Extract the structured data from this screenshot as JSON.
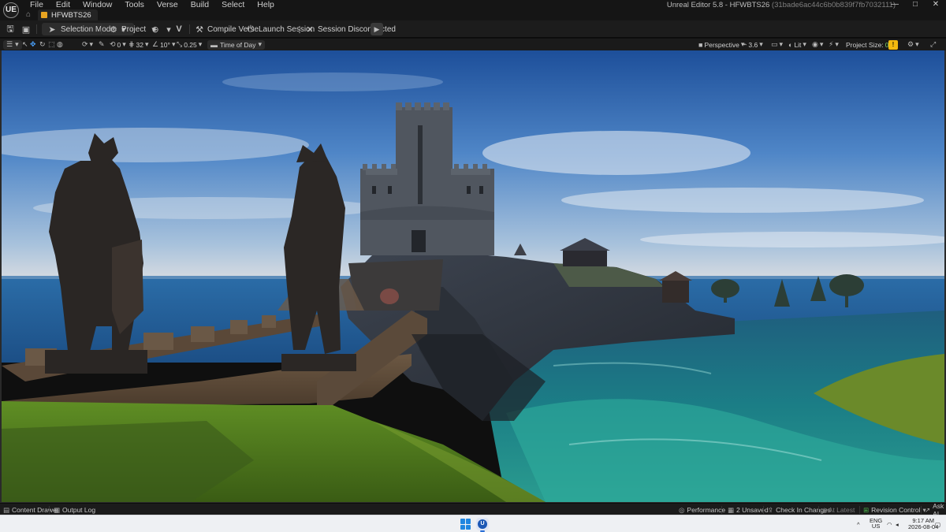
{
  "app": {
    "logo": "UE",
    "window_title": "Unreal Editor 5.8 - HFWBTS26",
    "window_hash": "(31bade6ac44c6b0b839f7fb7032111)",
    "menu": [
      "File",
      "Edit",
      "Window",
      "Tools",
      "Verse",
      "Build",
      "Select",
      "Help"
    ],
    "tab_label": "HFWBTS26",
    "window_controls": {
      "minimize": "—",
      "maximize": "□",
      "close": "✕"
    }
  },
  "toolbar": {
    "selection_mode": "Selection Mode",
    "project": "Project",
    "compile_verse": "Compile Verse",
    "launch_session": "Launch Session",
    "session_status": "Session Disconnected"
  },
  "viewport_toolbar": {
    "rotation_snap_value": "0",
    "grid_snap_value": "32",
    "angle_snap_value": "10°",
    "scale_snap_value": "0.25",
    "time_of_day": "Time of Day",
    "camera_mode": "Perspective",
    "camera_speed": "3.6",
    "view_mode": "Lit",
    "project_size_label": "Project Size:",
    "project_size_value": "0%"
  },
  "statusbar": {
    "content_drawer": "Content Drawer",
    "output_log": "Output Log",
    "performance": "Performance",
    "unsaved": "2 Unsaved",
    "check_in": "Check In Changes",
    "at_latest": "At Latest",
    "revision_control": "Revision Control",
    "ask_ai": "Ask AI"
  },
  "taskbar": {
    "lang_top": "ENG",
    "lang_bottom": "US",
    "time": "9:17 AM",
    "date": "2026-08-04"
  },
  "colors": {
    "accent_orange": "#e8a421",
    "project_size_green": "#7fd46a",
    "warning_yellow": "#f2b90f",
    "windows_blue": "#1f86e0"
  }
}
